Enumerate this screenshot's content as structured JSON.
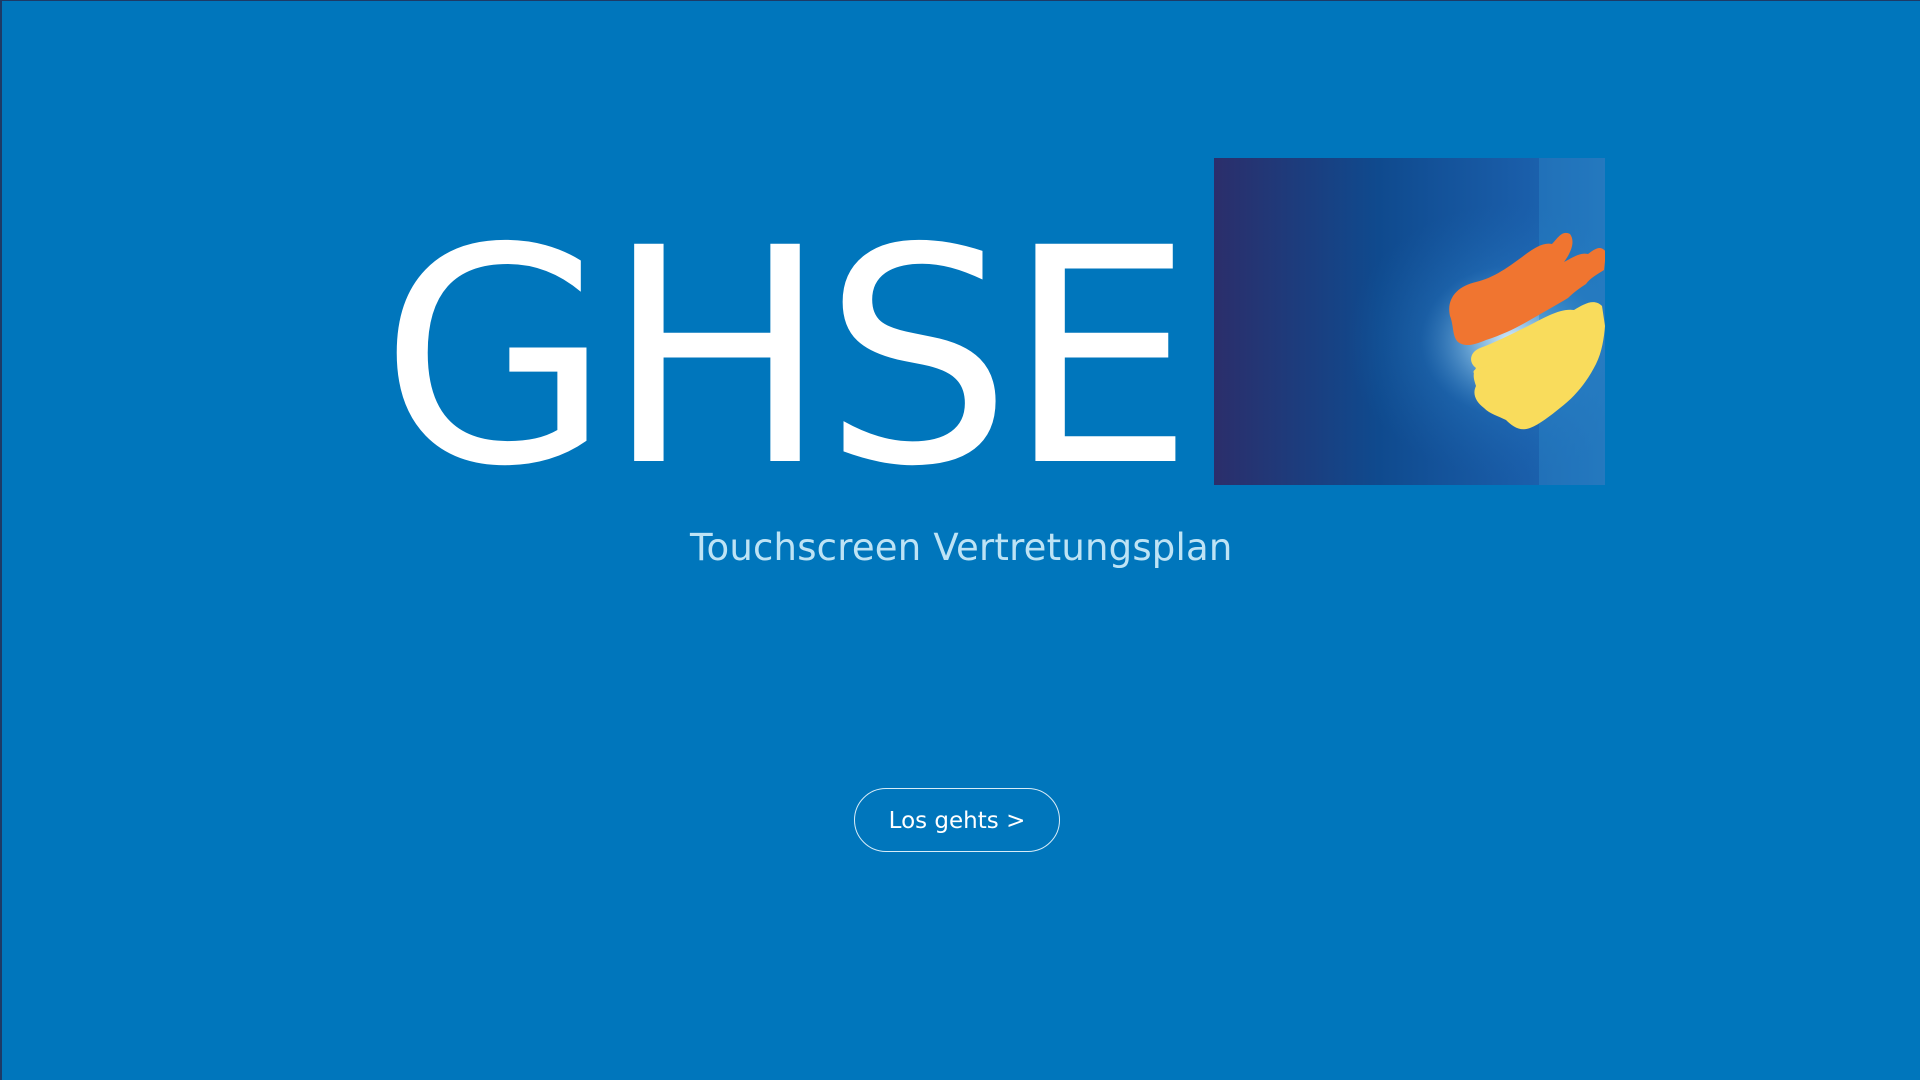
{
  "app": {
    "brand_title": "GHSE",
    "subtitle": "Touchscreen Vertretungsplan",
    "start_button_label": "Los gehts >"
  },
  "logo": {
    "icon": "school-logo-brush-strokes",
    "colors": {
      "background_dark": "#2b2e6b",
      "background_mid": "#0f4a8e",
      "background_light": "#1f7bc4",
      "stroke_orange": "#f07530",
      "stroke_yellow": "#f9dc5c",
      "glow": "#d6f0ff"
    }
  },
  "theme": {
    "background": "#0076bc",
    "text_primary": "#ffffff",
    "text_secondary": "#bde3f5",
    "button_border": "#d7ecf8"
  }
}
